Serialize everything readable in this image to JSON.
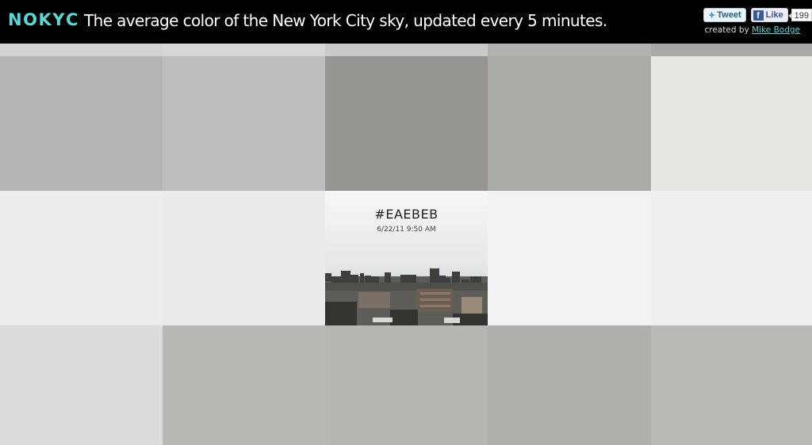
{
  "header": {
    "logo_letters": [
      "N",
      "O",
      "K",
      "Y",
      "C"
    ],
    "tagline": "The average color of the New York City sky, updated every 5 minutes.",
    "social": {
      "tweet_label": "Tweet",
      "like_label": "Like",
      "like_count": "199"
    },
    "credit_prefix": "created by",
    "credit_name": "Mike Bodge"
  },
  "colors": {
    "brand": "#5fd6d6",
    "header_bg": "#000000"
  },
  "grid": {
    "rows": [
      [
        "#d3d3d1",
        "#d7d8d6",
        "#cacaca",
        "#b1b3af",
        "#a9aaa6"
      ],
      [
        "#b5b5b3",
        "#bdbebb",
        "#969592",
        "#a9aba7",
        "#e6e6e3"
      ],
      [
        "#ebecec",
        "#ebebeb",
        "#eaebeb",
        "#f1f2f2",
        "#eef0f0"
      ],
      [
        "#dcdcda",
        "#b8b9b4",
        "#b5b7b2",
        "#afb0ab",
        "#b9bab5"
      ]
    ]
  },
  "featured": {
    "hex": "#EAEBEB",
    "timestamp": "6/22/11 9:50 AM"
  }
}
